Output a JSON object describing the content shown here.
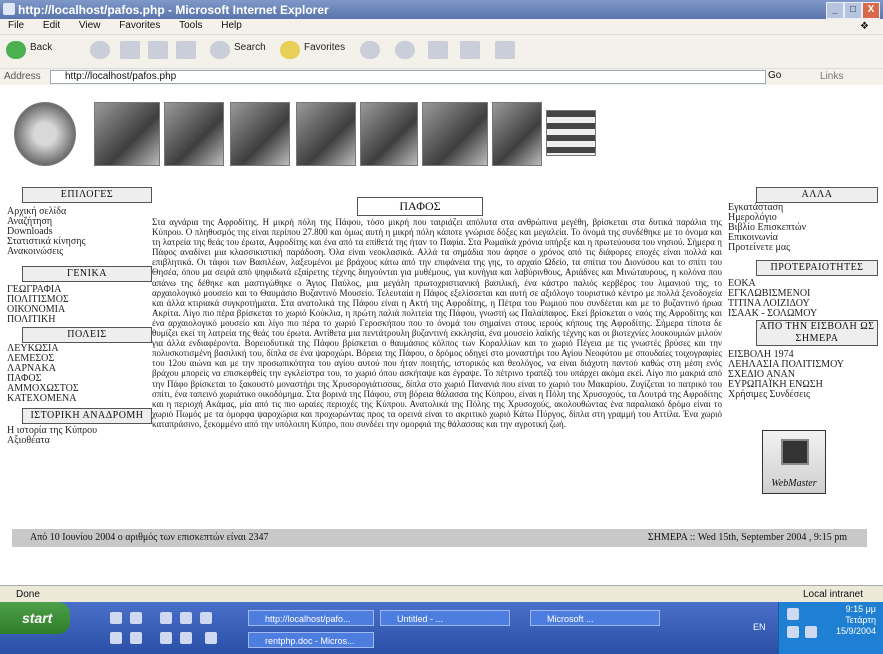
{
  "window": {
    "title": "http://localhost/pafos.php - Microsoft Internet Explorer",
    "controls": [
      "_",
      "□",
      "X"
    ]
  },
  "menu": [
    "File",
    "Edit",
    "View",
    "Favorites",
    "Tools",
    "Help"
  ],
  "toolbar": {
    "back": "Back",
    "search": "Search",
    "favorites": "Favorites"
  },
  "address": {
    "label": "Address",
    "url": "http://localhost/pafos.php",
    "go": "Go",
    "links": "Links"
  },
  "left_nav": {
    "options_header": "ΕΠΙΛΟΓΕΣ",
    "options": [
      "Αρχική σελίδα",
      "Αναζήτηση",
      "Downloads",
      "Στατιστικά κίνησης",
      "Ανακοινώσεις"
    ],
    "general_header": "ΓΕΝΙΚΑ",
    "general": [
      "ΓΕΩΓΡΑΦΙΑ",
      "ΠΟΛΙΤΙΣΜΟΣ",
      "ΟΙΚΟΝΟΜΙΑ",
      "ΠΟΛΙΤΙΚΗ"
    ],
    "cities_header": "ΠΟΛΕΙΣ",
    "cities": [
      "ΛΕΥΚΩΣΙΑ",
      "ΛΕΜΕΣΟΣ",
      "ΛΑΡΝΑΚΑ",
      "ΠΑΦΟΣ",
      "ΑΜΜΟΧΩΣΤΟΣ",
      "ΚΑΤΕΧΟΜΕΝΑ"
    ],
    "history_header": "ΙΣΤΟΡΙΚΗ ΑΝΑΔΡΟΜΗ",
    "history": [
      "Η ιστορία της Κύπρου",
      "Αξιοθέατα"
    ]
  },
  "center": {
    "title": "ΠΑΦΟΣ",
    "body": "Στα αγνάρια της Αφροδίτης. Η μικρή πόλη της Πάφου, τόσο μικρή που ταιριάζει απόλυτα στα ανθρώπινα μεγέθη, βρίσκεται στα δυτικά παράλια της Κύπρου. Ο πληθυσμός της είναι περίπου 27.800 και όμως αυτή η μικρή πόλη κάποτε γνώρισε δόξες και μεγαλεία. Το όνομά της συνδέθηκε με το όνομα και τη λατρεία της θεάς του έρωτα, Αφροδίτης και ένα από τα επίθετά της ήταν το Παφία. Στα Ρωμαϊκά χρόνια υπήρξε και η πρωτεύουσα του νησιού. Σήμερα η Πάφος αναδίνει μια κλασσικιστική παράδοση. Όλα είναι νεοκλασικά. Αλλά τα σημάδια που άφησε ο χρόνος από τις διάφορες εποχές είναι πολλά και επιβλητικά. Οι τάφοι των Βασιλέων, λαξευμένοι με βράχους κάτω από την επιφάνεια της γης, το αρχαίο Ωδείο, τα σπίτια του Διονύσου και το σπίτι του Θησέα, όπου μα σειρά από ψηφιδωτά εξαίρετης τέχνης διηγούνται για μυθέμους, για κυνήγια και λαβύρινθους, Αριάδνες και Μινώταυρους, η κολόνα που απάνω της δέθηκε και μαστιγώθηκε ο Άγιος Παύλος, μια μεγάλη πρωτοχριστιανική βασιλική, ένα κάστρο παλιός κερβέρος του λιμανιού της, το αρχαιολογικό μουσείο και το Θαυμάσιο Βυζαντινό Μουσείο. Τελευταία η Πάφος εξελίσσεται και αυτή σε αξιόλογο τουριστικό κέντρο με πολλά ξενοδοχεία και άλλα κτιριακά συγκροτήματα. Στα ανατολικά της Πάφου είναι η Ακτή της Αφροδίτης, η Πέτρα του Ρωμιού που συνδέεται και με το βυζαντινό ήρωα Ακρίτα. Λίγο πιο πέρα βρίσκεται το χωριό Κούκλια, η πρώτη παλιά πολιτεία της Πάφου, γνωστή ως Παλαίπαφος. Εκεί βρίσκεται ο ναός της Αφροδίτης και ένα αρχαιολογικό μουσείο και λίγο πιο πέρα το χωριό Γεροσκήπου που το όνομά του σημαίνει στους ιερούς κήπους της Αφροδίτης. Σήμερα τίποτα δε θυμίζει εκεί τη λατρεία της θεάς του έρωτα. Αντίθετα μια πεντάτρουλη βυζαντινή εκκλησία, ένα μουσείο λαϊκής τέχνης και οι βιοτεχνίες λουκουμιών μιλούν για άλλα ενδιαφέροντα. Βορειοδυτικά της Πάφου βρίσκεται ο θαυμάσιος κόλπος των Κοραλλίων και το χωριό Πέγεια με τις γνωστές βρύσες και την πολυσκοτισμένη βασιλική του, δίπλα σε ένα ψαροχώρι. Βόρεια της Πάφου, ο δρόμος οδηγεί στο μοναστήρι του Αγίου Νεοφύτου με σπουδαίες τοιχογραφίες του 12ου αιώνα και με την προσωπικότητα του αγίου αυτού που ήταν ποιητής, ιστορικός και θεολόγος, να είναι διάχυτη παντού καθώς στη μέση ενός βράχου μπορείς να επισκεφθείς την εγκλείστρα του, το χωριό όπου ασκήταψε και έγραψε. Το πέτρινο τραπέζι του υπάρχει ακόμα εκεί. Λίγο πιο μακριά από την Πάφο βρίσκεται το ξακουστό μοναστήρι της Χρυσορογιάτισσας, δίπλα στο χωριό Πανανιά που είναι το χωριό του Μακαρίου. Ζυγίζεται το πατρικό του σπίτι, ένα ταπεινό χωριάτικο οικοδόμημα. Στα βορινά της Πάφου, στη βόρεια θάλασσα της Κύπρου, είναι η Πόλη της Χρυσοχούς, τα Λουτρά της Αφροδίτης και η περιοχή Ακάμας, μία από τις πιο ωραίες περιοχές της Κύπρου. Ανατολικά της Πόλης της Χρυσοχούς, ακολουθώντας ένα παραλιακό δρόμο είναι το χωριό Πωμός με τα όμορφα ψαροχώρια και προχωρώντας προς τα ορεινά είναι το ακριτικό χωριό Κάτω Πύργος, δίπλα στη γραμμή του Αττίλα. Ένα χωριό καταπράσινο, ξεκομμένο από την υπόλοιπη Κύπρο, που συνδέει την ομορφιά της θάλασσας και την αγροτική ζωή."
  },
  "right_nav": {
    "other_header": "ΑΛΛΑ",
    "other": [
      "Εγκατάσταση",
      "Ημερολόγιο",
      "Βιβλίο Επισκεπτών",
      "Επικοινωνία",
      "Προτείνετε μας"
    ],
    "priorities_header": "ΠΡΟΤΕΡΑΙΟΤΗΤΕΣ",
    "priorities": [
      "ΕΟΚΑ",
      "ΕΓΚΛΩΒΙΣΜΕΝΟΙ",
      "ΤΙΤΙΝΑ ΛΟΙΖΙΔΟΥ",
      "ΙΣΑΑΚ - ΣΟΛΩΜΟΥ"
    ],
    "since_header": "ΑΠΟ ΤΗΝ ΕΙΣΒΟΛΗ ΩΣ ΣΗΜΕΡΑ",
    "since": [
      "ΕΙΣΒΟΛΗ 1974",
      "ΛΕΗΛΑΣΙΑ ΠΟΛΙΤΙΣΜΟΥ",
      "ΣΧΕΔΙΟ ΑΝΑΝ",
      "ΕΥΡΩΠΑΪΚΗ ΕΝΩΣΗ",
      "Χρήσιμες Συνδέσεις"
    ],
    "webmaster": "WebMaster"
  },
  "footer": {
    "visitors": "Από 10 Ιουνίου 2004 ο αριθμός των επισκεπτών είναι 2347",
    "today": "ΣΗΜΕΡΑ :: Wed 15th, September 2004 , 9:15 pm"
  },
  "status": {
    "text": "Done",
    "zone": "Local intranet"
  },
  "taskbar": {
    "start": "start",
    "tasks": [
      "http://localhost/pafo...",
      "Untitled - ...",
      "Microsoft ...",
      "rentphp.doc - Micros..."
    ],
    "lang": "EN",
    "clock": [
      "9:15 μμ",
      "Τετάρτη",
      "15/9/2004"
    ]
  }
}
